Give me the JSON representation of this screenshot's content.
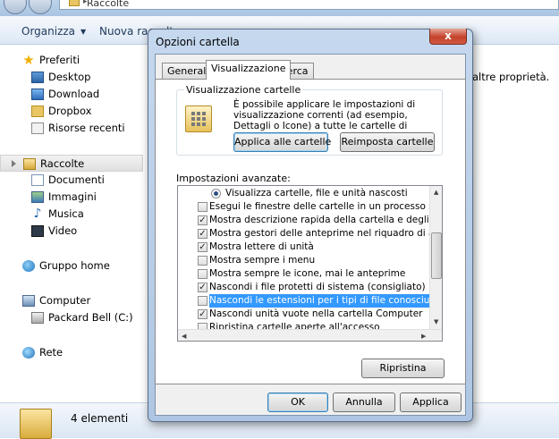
{
  "explorer": {
    "address": "Raccolte",
    "toolbar": {
      "organize": "Organizza",
      "new_collection": "Nuova raccolta"
    },
    "content_info": "altre proprietà.",
    "nav": {
      "favorites": "Preferiti",
      "desktop": "Desktop",
      "download": "Download",
      "dropbox": "Dropbox",
      "recent": "Risorse recenti",
      "libraries": "Raccolte",
      "documents": "Documenti",
      "images": "Immagini",
      "music": "Musica",
      "video": "Video",
      "homegroup": "Gruppo home",
      "computer": "Computer",
      "drive": "Packard Bell (C:)",
      "network": "Rete"
    },
    "details": {
      "count": "4 elementi"
    }
  },
  "dialog": {
    "title": "Opzioni cartella",
    "close": "x",
    "tabs": [
      "Generale",
      "Visualizzazione",
      "Cerca"
    ],
    "active_tab": "Visualizzazione",
    "folder_views": {
      "legend": "Visualizzazione cartelle",
      "description": "È possibile applicare le impostazioni di visualizzazione correnti (ad esempio, Dettagli o Icone) a tutte le cartelle di questo tipo.",
      "apply_button": "Applica alle cartelle",
      "reset_button": "Reimposta cartelle"
    },
    "advanced": {
      "label": "Impostazioni avanzate:",
      "items": [
        {
          "label": "Visualizza cartelle, file e unità nascosti",
          "type": "radio",
          "checked": true
        },
        {
          "label": "Esegui le finestre delle cartelle in un processo separato",
          "type": "checkbox",
          "checked": false
        },
        {
          "label": "Mostra descrizione rapida della cartella e degli oggetti del",
          "type": "checkbox",
          "checked": true
        },
        {
          "label": "Mostra gestori delle anteprime nel riquadro di anteprima",
          "type": "checkbox",
          "checked": true
        },
        {
          "label": "Mostra lettere di unità",
          "type": "checkbox",
          "checked": true
        },
        {
          "label": "Mostra sempre i menu",
          "type": "checkbox",
          "checked": false
        },
        {
          "label": "Mostra sempre le icone, mai le anteprime",
          "type": "checkbox",
          "checked": false
        },
        {
          "label": "Nascondi i file protetti di sistema (consigliato)",
          "type": "checkbox",
          "checked": true
        },
        {
          "label": "Nascondi le estensioni per i tipi di file conosciuti",
          "type": "checkbox",
          "checked": false,
          "selected": true
        },
        {
          "label": "Nascondi unità vuote nella cartella Computer",
          "type": "checkbox",
          "checked": true
        },
        {
          "label": "Ripristina cartelle aperte all'accesso",
          "type": "checkbox",
          "checked": false
        }
      ],
      "restore_button": "Ripristina"
    },
    "buttons": {
      "ok": "OK",
      "cancel": "Annulla",
      "apply": "Applica"
    }
  },
  "colors": {
    "selection": "#3399ff",
    "dialog_frame": "#aec6e3",
    "close_button": "#c4422b"
  }
}
